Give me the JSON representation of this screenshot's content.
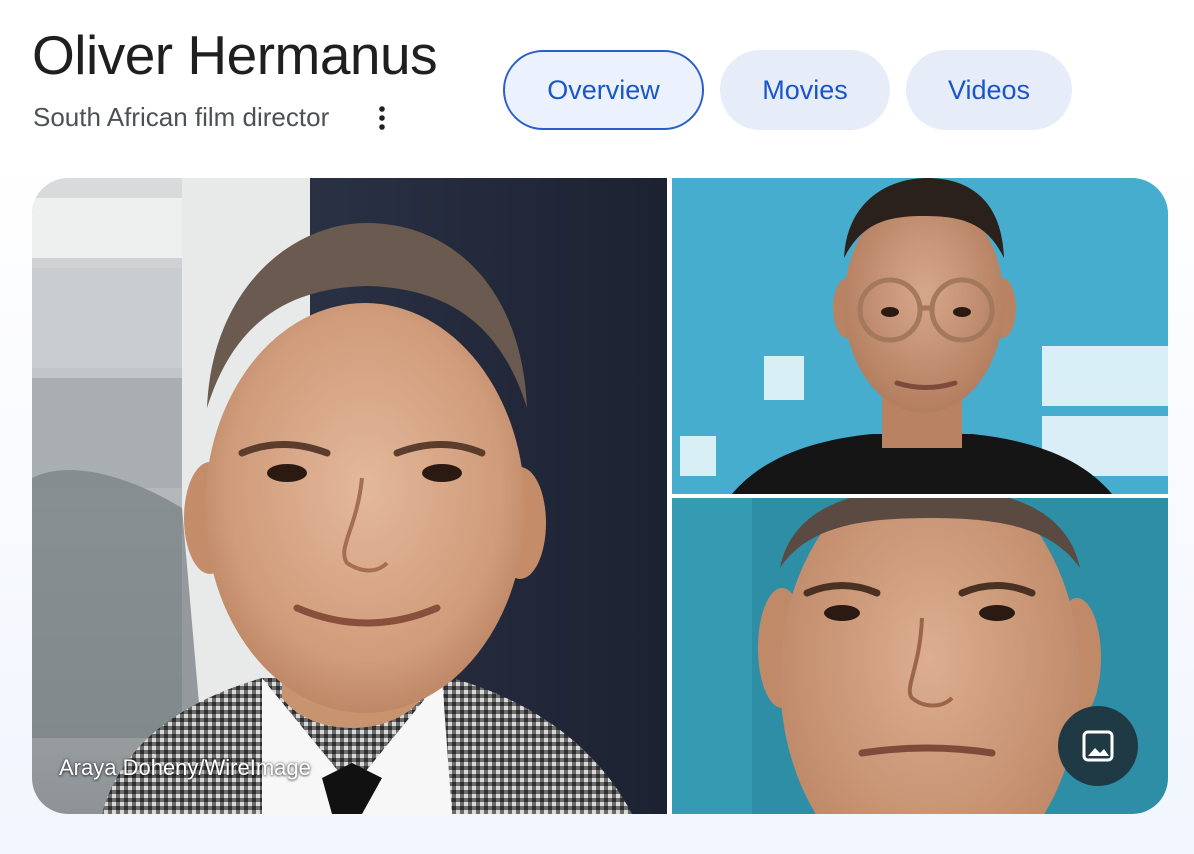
{
  "header": {
    "title": "Oliver Hermanus",
    "subtitle": "South African film director"
  },
  "chips": [
    {
      "label": "Overview",
      "selected": true
    },
    {
      "label": "Movies",
      "selected": false
    },
    {
      "label": "Videos",
      "selected": false
    }
  ],
  "images": {
    "main": {
      "credit": "Araya Doheny/WireImage"
    }
  },
  "icons": {
    "more": "more-vert-icon",
    "images": "image-icon"
  },
  "colors": {
    "chip_text": "#1a56c7",
    "chip_bg": "#e6edf9",
    "chip_border_active": "#2b5ec9",
    "images_button_bg": "#1f3a45"
  }
}
